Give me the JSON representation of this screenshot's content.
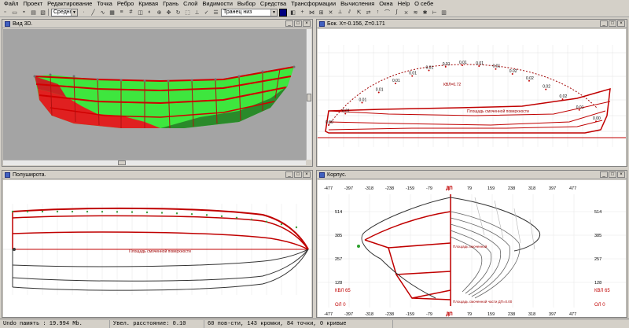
{
  "menu": [
    "Файл",
    "Проект",
    "Редактирование",
    "Точка",
    "Ребро",
    "Кривая",
    "Грань",
    "Слой",
    "Видимости",
    "Выбор",
    "Средства",
    "Трансформации",
    "Вычисления",
    "Окна",
    "Help",
    "О себе"
  ],
  "toolbar": {
    "precision_value": "Средняя",
    "view_value": "Транец низ",
    "color_swatch": "#000080"
  },
  "windows": {
    "view3d": {
      "title": "Вид 3D."
    },
    "side": {
      "title": "Бок.  X=-0.156,  Z=0.171"
    },
    "plan": {
      "title": "Полуширота."
    },
    "body": {
      "title": "Корпус."
    }
  },
  "labels": {
    "side_kvl": "КВЛ=0.72",
    "side_area": "Площадь смоченной поверхности",
    "plan_area": "Площадь смоченной поверхности",
    "body_dp_top": "ДП",
    "body_dp_bottom": "ДП",
    "body_kvl_left": "КВЛ 65",
    "body_kvl_right": "КВЛ 65",
    "body_ob_left": "ОЛ 0",
    "body_ob_right": "ОЛ 0",
    "body_area": "Площадь смоченной",
    "body_mid": "Площадь смоченной части ДП=0.00"
  },
  "body_ticks_x": [
    "-477",
    "-397",
    "-318",
    "-238",
    "-159",
    "-79",
    "ДП",
    "79",
    "159",
    "238",
    "318",
    "397",
    "477"
  ],
  "body_ticks_y": [
    "514",
    "385",
    "257",
    "128"
  ],
  "side_stations": [
    "0.00",
    "0.01",
    "0.01",
    "0.01",
    "0.01",
    "0.01",
    "0.01",
    "0.01",
    "0.01",
    "0.01",
    "0.01",
    "0.02",
    "0.02",
    "0.02",
    "0.02",
    "0.01",
    "0.00"
  ],
  "status": {
    "undo": "Undo память : 19.994 Mb.",
    "zoom": "Увел. расстояние: 0.10",
    "stats": "60 пов-сти, 143 кромки, 84 точки, 0 кривые"
  },
  "colors": {
    "hull_green": "#3ee63e",
    "hull_red": "#e02020",
    "grid_red": "#d00000"
  }
}
